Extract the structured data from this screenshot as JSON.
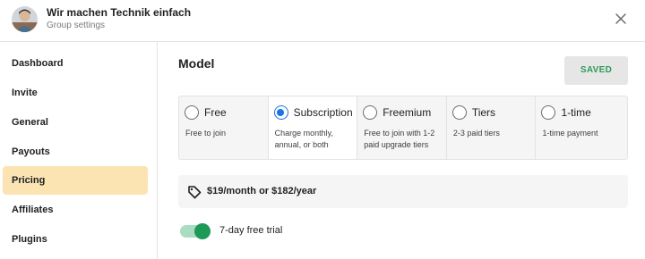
{
  "header": {
    "group_name": "Wir machen Technik einfach",
    "subtitle": "Group settings",
    "avatar_icon": "user-avatar",
    "close_icon": "close-icon"
  },
  "sidebar": {
    "items": [
      {
        "label": "Dashboard",
        "active": false
      },
      {
        "label": "Invite",
        "active": false
      },
      {
        "label": "General",
        "active": false
      },
      {
        "label": "Payouts",
        "active": false
      },
      {
        "label": "Pricing",
        "active": true
      },
      {
        "label": "Affiliates",
        "active": false
      },
      {
        "label": "Plugins",
        "active": false
      }
    ]
  },
  "main": {
    "title": "Model",
    "saved_label": "SAVED",
    "models": [
      {
        "label": "Free",
        "description": "Free to join",
        "selected": false
      },
      {
        "label": "Subscription",
        "description": "Charge monthly, annual, or both",
        "selected": true
      },
      {
        "label": "Freemium",
        "description": "Free to join with 1-2 paid upgrade tiers",
        "selected": false
      },
      {
        "label": "Tiers",
        "description": "2-3 paid tiers",
        "selected": false
      },
      {
        "label": "1-time",
        "description": "1-time payment",
        "selected": false
      }
    ],
    "price_icon": "tag-icon",
    "price_text": "$19/month or $182/year",
    "trial_label": "7-day free trial",
    "trial_enabled": true
  },
  "colors": {
    "accent_blue": "#1a73e8",
    "active_nav": "#fbe3b2",
    "saved_green": "#2e9a5c",
    "toggle_green": "#1e9a57"
  }
}
